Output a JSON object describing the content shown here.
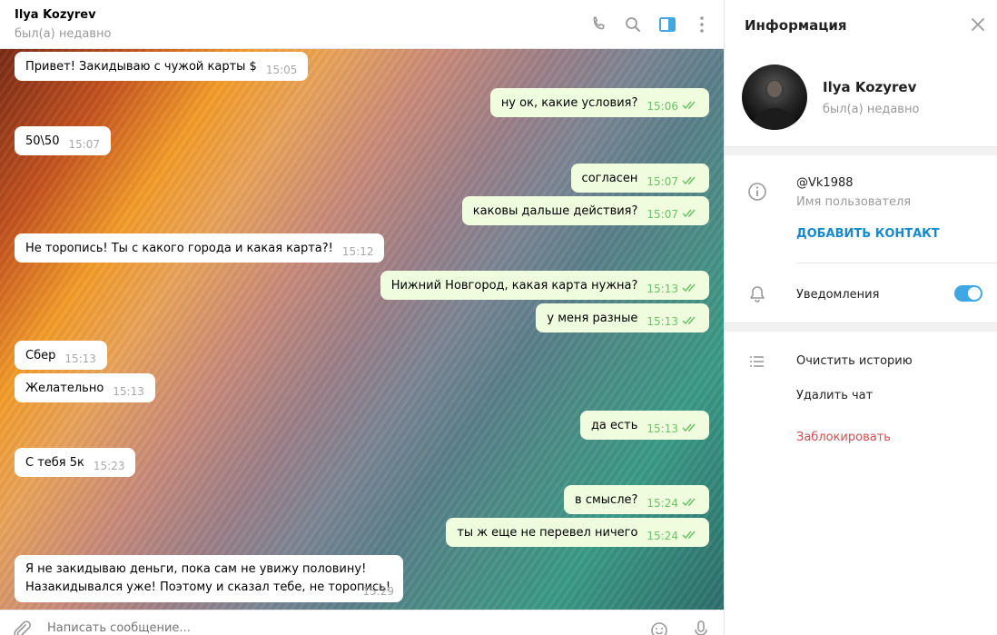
{
  "chat": {
    "name": "Ilya Kozyrev",
    "status": "был(а) недавно",
    "icons": [
      "phone-icon",
      "search-icon",
      "sidebar-toggle-icon",
      "more-icon"
    ]
  },
  "messages": [
    {
      "dir": "in",
      "text": "Привет! Закидываю с чужой карты $",
      "time": "15:05"
    },
    {
      "dir": "out",
      "text": "ну ок, какие условия?",
      "time": "15:06"
    },
    {
      "dir": "in",
      "text": "50\\50",
      "time": "15:07"
    },
    {
      "dir": "out",
      "text": "согласен",
      "time": "15:07"
    },
    {
      "dir": "out",
      "text": "каковы дальше действия?",
      "time": "15:07"
    },
    {
      "dir": "in",
      "text": "Не торопись! Ты с какого города и какая карта?!",
      "time": "15:12"
    },
    {
      "dir": "out",
      "text": "Нижний Новгород, какая карта нужна?",
      "time": "15:13"
    },
    {
      "dir": "out",
      "text": "у меня разные",
      "time": "15:13"
    },
    {
      "dir": "in",
      "text": "Сбер",
      "time": "15:13"
    },
    {
      "dir": "in",
      "text": "Желательно",
      "time": "15:13"
    },
    {
      "dir": "out",
      "text": "да есть",
      "time": "15:13"
    },
    {
      "dir": "in",
      "text": "С тебя 5к",
      "time": "15:23"
    },
    {
      "dir": "out",
      "text": "в смысле?",
      "time": "15:24"
    },
    {
      "dir": "out",
      "text": "ты ж еще не перевел ничего",
      "time": "15:24"
    },
    {
      "dir": "in",
      "text": "Я не закидываю деньги, пока сам не увижу половину! Назакидывался уже! Поэтому и сказал тебе, не торопись!",
      "time": "15:29"
    }
  ],
  "composer": {
    "placeholder": "Написать сообщение..."
  },
  "info": {
    "title": "Информация",
    "profile": {
      "name": "Ilya Kozyrev",
      "status": "был(а) недавно"
    },
    "username": "@Vk1988",
    "username_caption": "Имя пользователя",
    "add_contact": "ДОБАВИТЬ КОНТАКТ",
    "notifications_label": "Уведомления",
    "notifications_on": true,
    "actions": {
      "clear_history": "Очистить историю",
      "delete_chat": "Удалить чат",
      "block": "Заблокировать"
    }
  },
  "colors": {
    "accent": "#40a7e3",
    "link": "#168acd",
    "danger": "#d14e4e",
    "outgoing_bubble": "#effdde",
    "outgoing_time": "#6cc264"
  }
}
